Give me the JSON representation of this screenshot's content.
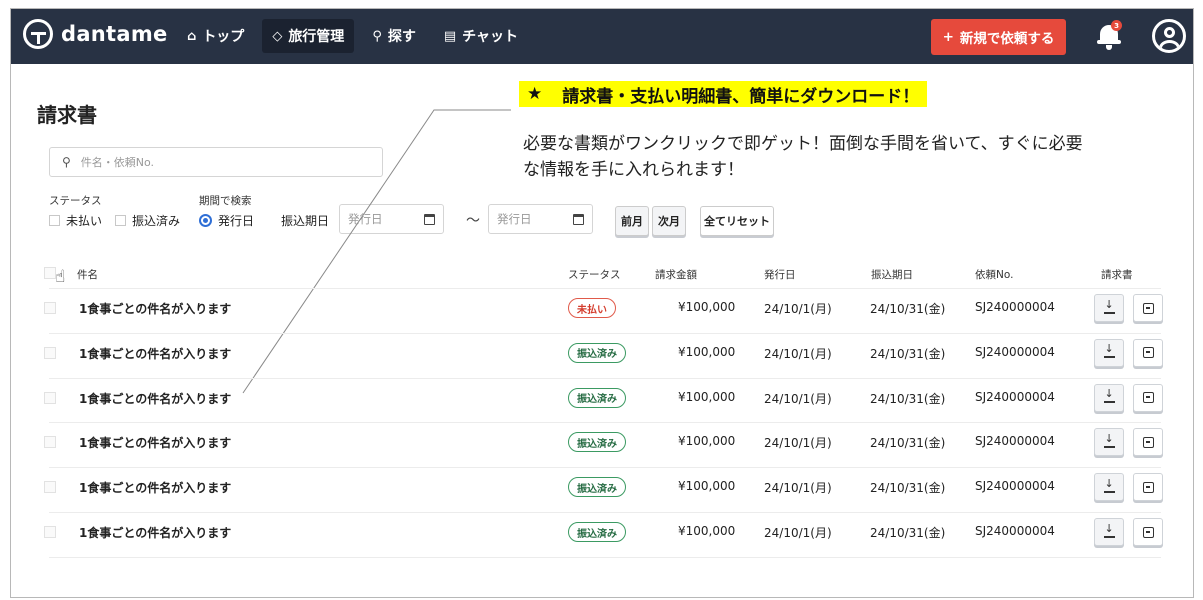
{
  "header": {
    "logo_text": "dantame",
    "nav": [
      {
        "label": "トップ",
        "icon": "home-icon"
      },
      {
        "label": "旅行管理",
        "icon": "tag-icon"
      },
      {
        "label": "探す",
        "icon": "search-icon"
      },
      {
        "label": "チャット",
        "icon": "chat-icon"
      }
    ],
    "new_request_label": "新規で依頼する",
    "new_request_plus": "+",
    "notification_count": "3"
  },
  "page": {
    "title": "請求書",
    "search_placeholder": "件名・依頼No.",
    "status_label": "ステータス",
    "status_options": [
      "未払い",
      "振込済み"
    ],
    "period_label": "期間で検索",
    "period_selected": "発行日",
    "period_other": "振込期日",
    "date_from_placeholder": "発行日",
    "date_to_placeholder": "発行日",
    "range_separator": "〜",
    "prev_month": "前月",
    "next_month": "次月",
    "reset_all": "全てリセット"
  },
  "promo": {
    "star": "★",
    "headline": "請求書・支払い明細書、簡単にダウンロード！",
    "body": "必要な書類がワンクリックで即ゲット！面倒な手間を省いて、すぐに必要な情報を手に入れられます！"
  },
  "table": {
    "columns": [
      "件名",
      "ステータス",
      "請求金額",
      "発行日",
      "振込期日",
      "依頼No.",
      "請求書"
    ],
    "rows": [
      {
        "subject": "1食事ごとの件名が入ります",
        "status": "未払い",
        "status_type": "unpaid",
        "amount": "¥100,000",
        "issued": "24/10/1(月)",
        "due": "24/10/31(金)",
        "request_no": "SJ240000004"
      },
      {
        "subject": "1食事ごとの件名が入ります",
        "status": "振込済み",
        "status_type": "paid",
        "amount": "¥100,000",
        "issued": "24/10/1(月)",
        "due": "24/10/31(金)",
        "request_no": "SJ240000004"
      },
      {
        "subject": "1食事ごとの件名が入ります",
        "status": "振込済み",
        "status_type": "paid",
        "amount": "¥100,000",
        "issued": "24/10/1(月)",
        "due": "24/10/31(金)",
        "request_no": "SJ240000004"
      },
      {
        "subject": "1食事ごとの件名が入ります",
        "status": "振込済み",
        "status_type": "paid",
        "amount": "¥100,000",
        "issued": "24/10/1(月)",
        "due": "24/10/31(金)",
        "request_no": "SJ240000004"
      },
      {
        "subject": "1食事ごとの件名が入ります",
        "status": "振込済み",
        "status_type": "paid",
        "amount": "¥100,000",
        "issued": "24/10/1(月)",
        "due": "24/10/31(金)",
        "request_no": "SJ240000004"
      },
      {
        "subject": "1食事ごとの件名が入ります",
        "status": "振込済み",
        "status_type": "paid",
        "amount": "¥100,000",
        "issued": "24/10/1(月)",
        "due": "24/10/31(金)",
        "request_no": "SJ240000004"
      }
    ]
  },
  "colors": {
    "nav_bg": "#283244",
    "accent_red": "#e64a3c",
    "highlight_yellow": "#ffff00",
    "paid_green": "#3b9a62"
  }
}
